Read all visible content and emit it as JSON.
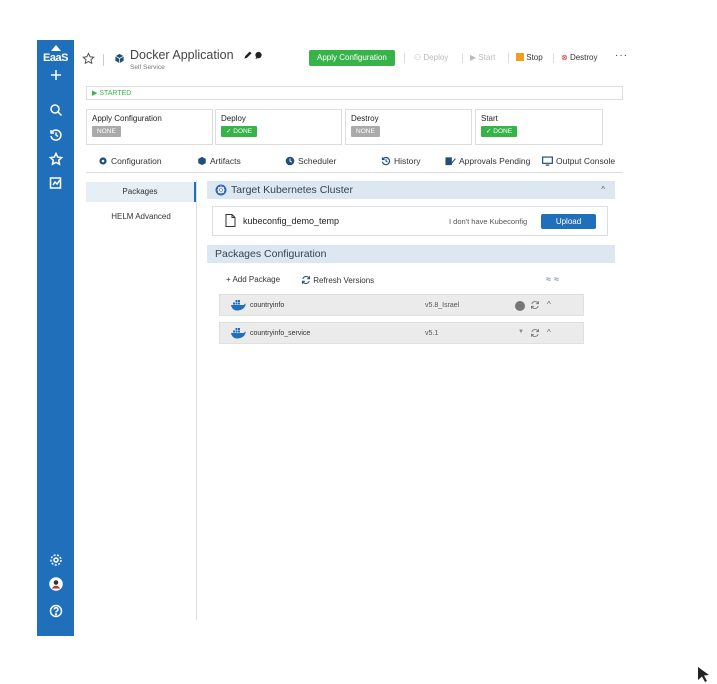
{
  "brand": {
    "logo_text": "EaaS"
  },
  "header": {
    "title": "Docker Application",
    "subtitle": "Self Service",
    "apply_label": "Apply Configuration",
    "deploy_label": "Deploy",
    "start_label": "Start",
    "stop_label": "Stop",
    "destroy_label": "Destroy",
    "more_label": "···"
  },
  "status": {
    "label": "STARTED"
  },
  "steps": [
    {
      "name": "Apply Configuration",
      "badge": "NONE"
    },
    {
      "name": "Deploy",
      "badge": "✓ DONE"
    },
    {
      "name": "Destroy",
      "badge": "NONE"
    },
    {
      "name": "Start",
      "badge": "✓ DONE"
    }
  ],
  "tabs": [
    {
      "label": "Configuration"
    },
    {
      "label": "Artifacts"
    },
    {
      "label": "Scheduler"
    },
    {
      "label": "History"
    },
    {
      "label": "Approvals Pending"
    },
    {
      "label": "Output Console"
    }
  ],
  "subnav": [
    {
      "label": "Packages"
    },
    {
      "label": "HELM Advanced"
    }
  ],
  "target_section": {
    "title": "Target Kubernetes Cluster",
    "file_name": "kubeconfig_demo_temp",
    "no_kubeconfig": "I don't have Kubeconfig",
    "upload_label": "Upload"
  },
  "packages_section": {
    "title": "Packages Configuration",
    "add_label": "+ Add Package",
    "refresh_label": "Refresh Versions",
    "rows": [
      {
        "name": "countryinfo",
        "version": "v5.8_Israel"
      },
      {
        "name": "countryinfo_service",
        "version": "v5.1"
      }
    ]
  },
  "colors": {
    "rail": "#1f6fba",
    "accent_green": "#37b34a",
    "section_bg": "#dde7f1"
  }
}
